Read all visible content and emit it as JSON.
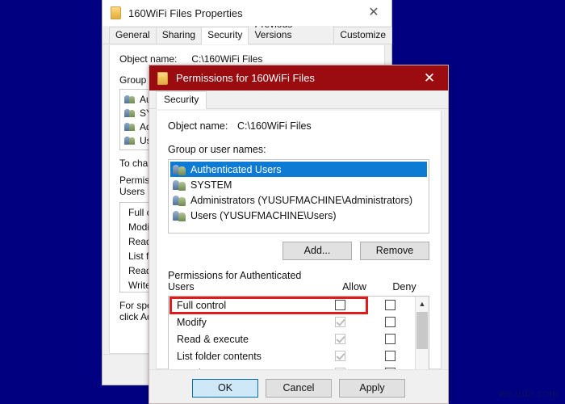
{
  "desktop": {
    "background_color": "#000080",
    "watermark": "ws.edn.com"
  },
  "properties_window": {
    "title": "160WiFi Files Properties",
    "title_icon": "folder-icon",
    "close_icon": "close-icon",
    "tabs": [
      {
        "label": "General",
        "active": false
      },
      {
        "label": "Sharing",
        "active": false
      },
      {
        "label": "Security",
        "active": true
      },
      {
        "label": "Previous Versions",
        "active": false
      },
      {
        "label": "Customize",
        "active": false
      }
    ],
    "object_name_label": "Object name:",
    "object_name_value": "C:\\160WiFi Files",
    "group_label": "Group or user names:",
    "group_items": [
      "Authenticated Users",
      "SYSTEM",
      "Administrators (YUSUFMACHINE\\Administrators)",
      "Users (YUSUFMACHINE\\Users)"
    ],
    "to_change_text": "To change permissions, click Edit.",
    "permissions_label_line1": "Permissions for Authenticated",
    "permissions_label_line2": "Users",
    "permission_rows": [
      "Full control",
      "Modify",
      "Read & execute",
      "List folder contents",
      "Read",
      "Write"
    ],
    "footer_line1": "For special permissions or advanced settings,",
    "footer_line2": "click Advanced."
  },
  "permissions_dialog": {
    "title": "Permissions for 160WiFi Files",
    "title_icon": "folder-icon",
    "titlebar_color": "#9b0c10",
    "close_icon": "close-icon",
    "tab": {
      "label": "Security",
      "active": true
    },
    "object_name_label": "Object name:",
    "object_name_value": "C:\\160WiFi Files",
    "group_label": "Group or user names:",
    "group_items": [
      {
        "name": "Authenticated Users",
        "icon": "users-icon",
        "selected": true
      },
      {
        "name": "SYSTEM",
        "icon": "users-icon",
        "selected": false
      },
      {
        "name": "Administrators (YUSUFMACHINE\\Administrators)",
        "icon": "users-icon",
        "selected": false
      },
      {
        "name": "Users (YUSUFMACHINE\\Users)",
        "icon": "users-icon",
        "selected": false
      }
    ],
    "add_button": "Add...",
    "remove_button": "Remove",
    "permissions_header_line1": "Permissions for Authenticated",
    "permissions_header_line2": "Users",
    "column_allow": "Allow",
    "column_deny": "Deny",
    "permission_rows": [
      {
        "name": "Full control",
        "allow": "unchecked",
        "deny": "unchecked",
        "highlighted": true
      },
      {
        "name": "Modify",
        "allow": "checked-dimmed",
        "deny": "unchecked",
        "highlighted": false
      },
      {
        "name": "Read & execute",
        "allow": "checked-dimmed",
        "deny": "unchecked",
        "highlighted": false
      },
      {
        "name": "List folder contents",
        "allow": "checked-dimmed",
        "deny": "unchecked",
        "highlighted": false
      },
      {
        "name": "Read",
        "allow": "checked-dimmed",
        "deny": "unchecked",
        "highlighted": false
      }
    ],
    "scroll_up_icon": "chevron-up-icon",
    "scroll_down_icon": "chevron-down-icon",
    "highlight_color": "#e01b1b",
    "selection_color": "#0d7bd4",
    "footer_buttons": [
      {
        "label": "OK",
        "default": true
      },
      {
        "label": "Cancel",
        "default": false
      },
      {
        "label": "Apply",
        "default": false
      }
    ]
  }
}
